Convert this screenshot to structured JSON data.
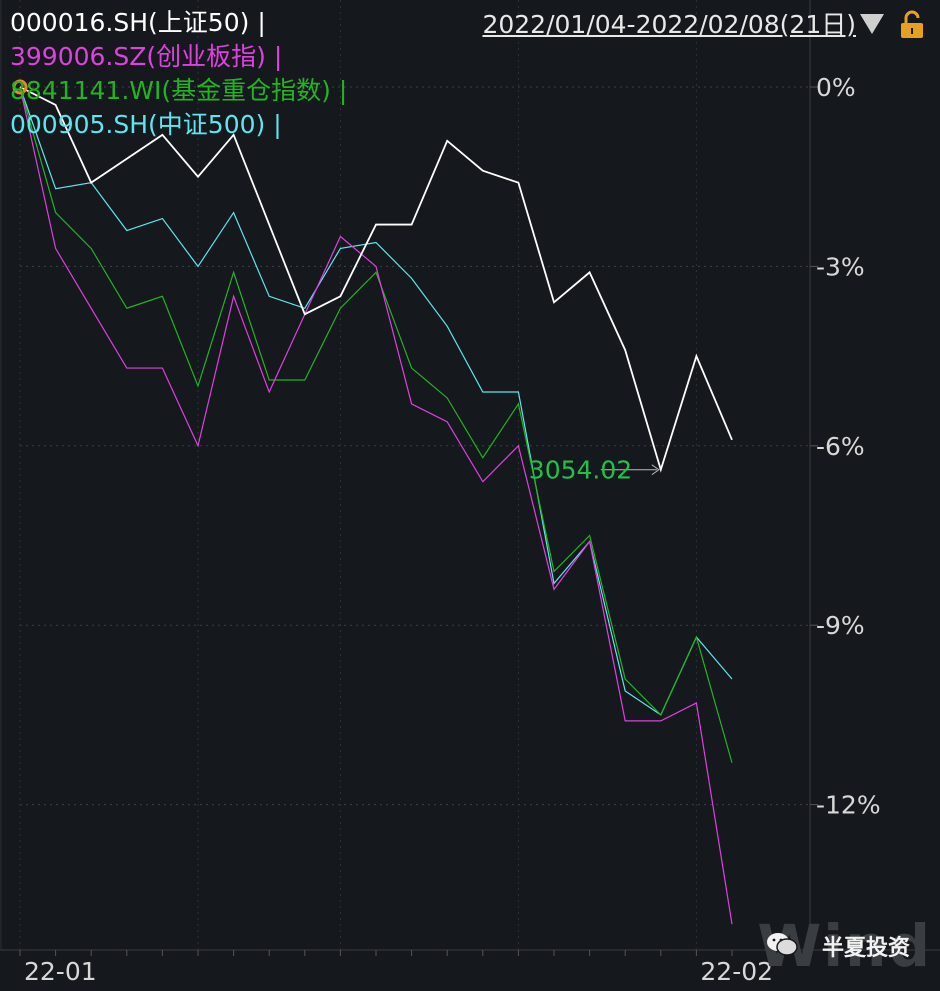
{
  "header": {
    "range_label": "2022/01/04-2022/02/08(21日)"
  },
  "legend": [
    {
      "label": "000016.SH(上证50)",
      "color": "#ffffff"
    },
    {
      "label": "399006.SZ(创业板指)",
      "color": "#e040e0"
    },
    {
      "label": "8841141.WI(基金重仓指数)",
      "color": "#22b422"
    },
    {
      "label": "000905.SH(中证500)",
      "color": "#5ee6ee"
    }
  ],
  "legend_separator": "|",
  "watermark": {
    "text": "半夏投资",
    "brand": "Wind"
  },
  "chart_data": {
    "type": "line",
    "y_unit": "%",
    "ylim": [
      -14.5,
      0.6
    ],
    "y_ticks": [
      0,
      -3,
      -6,
      -9,
      -12
    ],
    "y_tick_labels": [
      "0%",
      "-3%",
      "-6%",
      "-9%",
      "-12%"
    ],
    "x_tick_labels": [
      {
        "label": "22-01",
        "index": 0
      },
      {
        "label": "22-02",
        "index": 19
      }
    ],
    "grid": true,
    "annotation": {
      "text": "3054.02",
      "series": 0,
      "index": 18,
      "color": "#22c04a"
    },
    "series": [
      {
        "name": "000016.SH(上证50)",
        "color": "#ffffff",
        "values": [
          0,
          -0.3,
          -1.6,
          -1.2,
          -0.8,
          -1.5,
          -0.8,
          -2.3,
          -3.8,
          -3.5,
          -2.3,
          -2.3,
          -0.9,
          -1.4,
          -1.6,
          -3.6,
          -3.1,
          -4.4,
          -6.4,
          -4.5,
          -5.9
        ]
      },
      {
        "name": "399006.SZ(创业板指)",
        "color": "#e040e0",
        "values": [
          0,
          -2.7,
          -3.7,
          -4.7,
          -4.7,
          -6.0,
          -3.5,
          -5.1,
          -3.8,
          -2.5,
          -3.0,
          -5.3,
          -5.6,
          -6.6,
          -6.0,
          -8.4,
          -7.6,
          -10.6,
          -10.6,
          -10.3,
          -14.0
        ]
      },
      {
        "name": "8841141.WI(基金重仓指数)",
        "color": "#22b422",
        "values": [
          0,
          -2.1,
          -2.7,
          -3.7,
          -3.5,
          -5.0,
          -3.1,
          -4.9,
          -4.9,
          -3.7,
          -3.1,
          -4.7,
          -5.2,
          -6.2,
          -5.3,
          -8.1,
          -7.5,
          -9.9,
          -10.5,
          -9.2,
          -11.3
        ]
      },
      {
        "name": "000905.SH(中证500)",
        "color": "#5ee6ee",
        "values": [
          0,
          -1.7,
          -1.6,
          -2.4,
          -2.2,
          -3.0,
          -2.1,
          -3.5,
          -3.7,
          -2.7,
          -2.6,
          -3.2,
          -4.0,
          -5.1,
          -5.1,
          -8.3,
          -7.6,
          -10.1,
          -10.5,
          -9.2,
          -9.9
        ]
      }
    ]
  }
}
